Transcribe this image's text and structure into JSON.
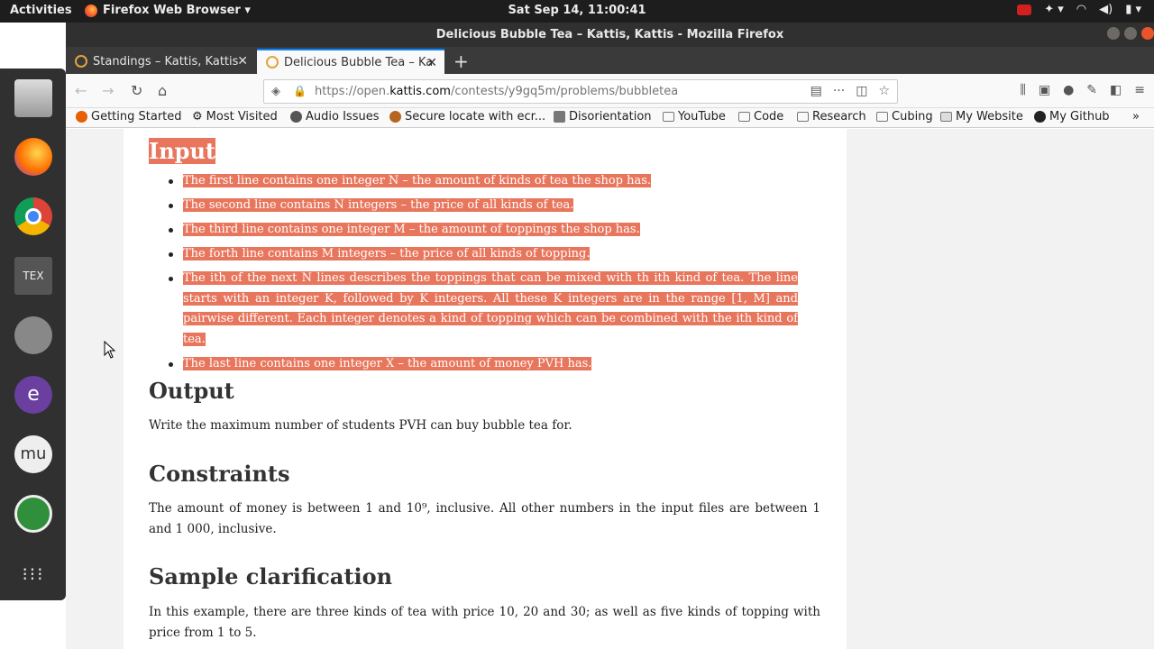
{
  "topbar": {
    "activities": "Activities",
    "app": "Firefox Web Browser",
    "clock": "Sat Sep 14, 11:00:41"
  },
  "window": {
    "title": "Delicious Bubble Tea – Kattis, Kattis - Mozilla Firefox"
  },
  "tabs": [
    {
      "label": "Standings – Kattis, Kattis"
    },
    {
      "label": "Delicious Bubble Tea – Ka"
    }
  ],
  "nav": {
    "url_prefix": "https://open.",
    "url_domain": "kattis.com",
    "url_path": "/contests/y9gq5m/problems/bubbletea"
  },
  "bookmarks": [
    "Getting Started",
    "Most Visited",
    "Audio Issues",
    "Secure locate with ecr...",
    "Disorientation",
    "YouTube",
    "Code",
    "Research",
    "Cubing",
    "My Website",
    "My Github"
  ],
  "problem": {
    "input_heading": "Input",
    "input_items": [
      "The first line contains one integer N – the amount of kinds of tea the shop has.",
      "The second line contains N integers – the price of all kinds of tea.",
      "The third line contains one integer M – the amount of toppings the shop has.",
      "The forth line contains M integers – the price of all kinds of topping.",
      "The ith of the next N lines describes the toppings that can be mixed with th ith kind of tea. The line starts with an integer K, followed by K integers. All these K integers are in the range [1, M] and pairwise different. Each integer denotes a kind of topping which can be combined with the ith kind of tea.",
      "The last line contains one integer X – the amount of money PVH has."
    ],
    "output_heading": "Output",
    "output_text": "Write the maximum number of students PVH can buy bubble tea for.",
    "constraints_heading": "Constraints",
    "constraints_text": "The amount of money is between 1 and 10⁹, inclusive. All other numbers in the input files are between 1 and 1 000, inclusive.",
    "sample_heading": "Sample clarification",
    "sample_text": "In this example, there are three kinds of tea with price 10, 20 and 30; as well as five kinds of topping with price from 1 to 5."
  }
}
